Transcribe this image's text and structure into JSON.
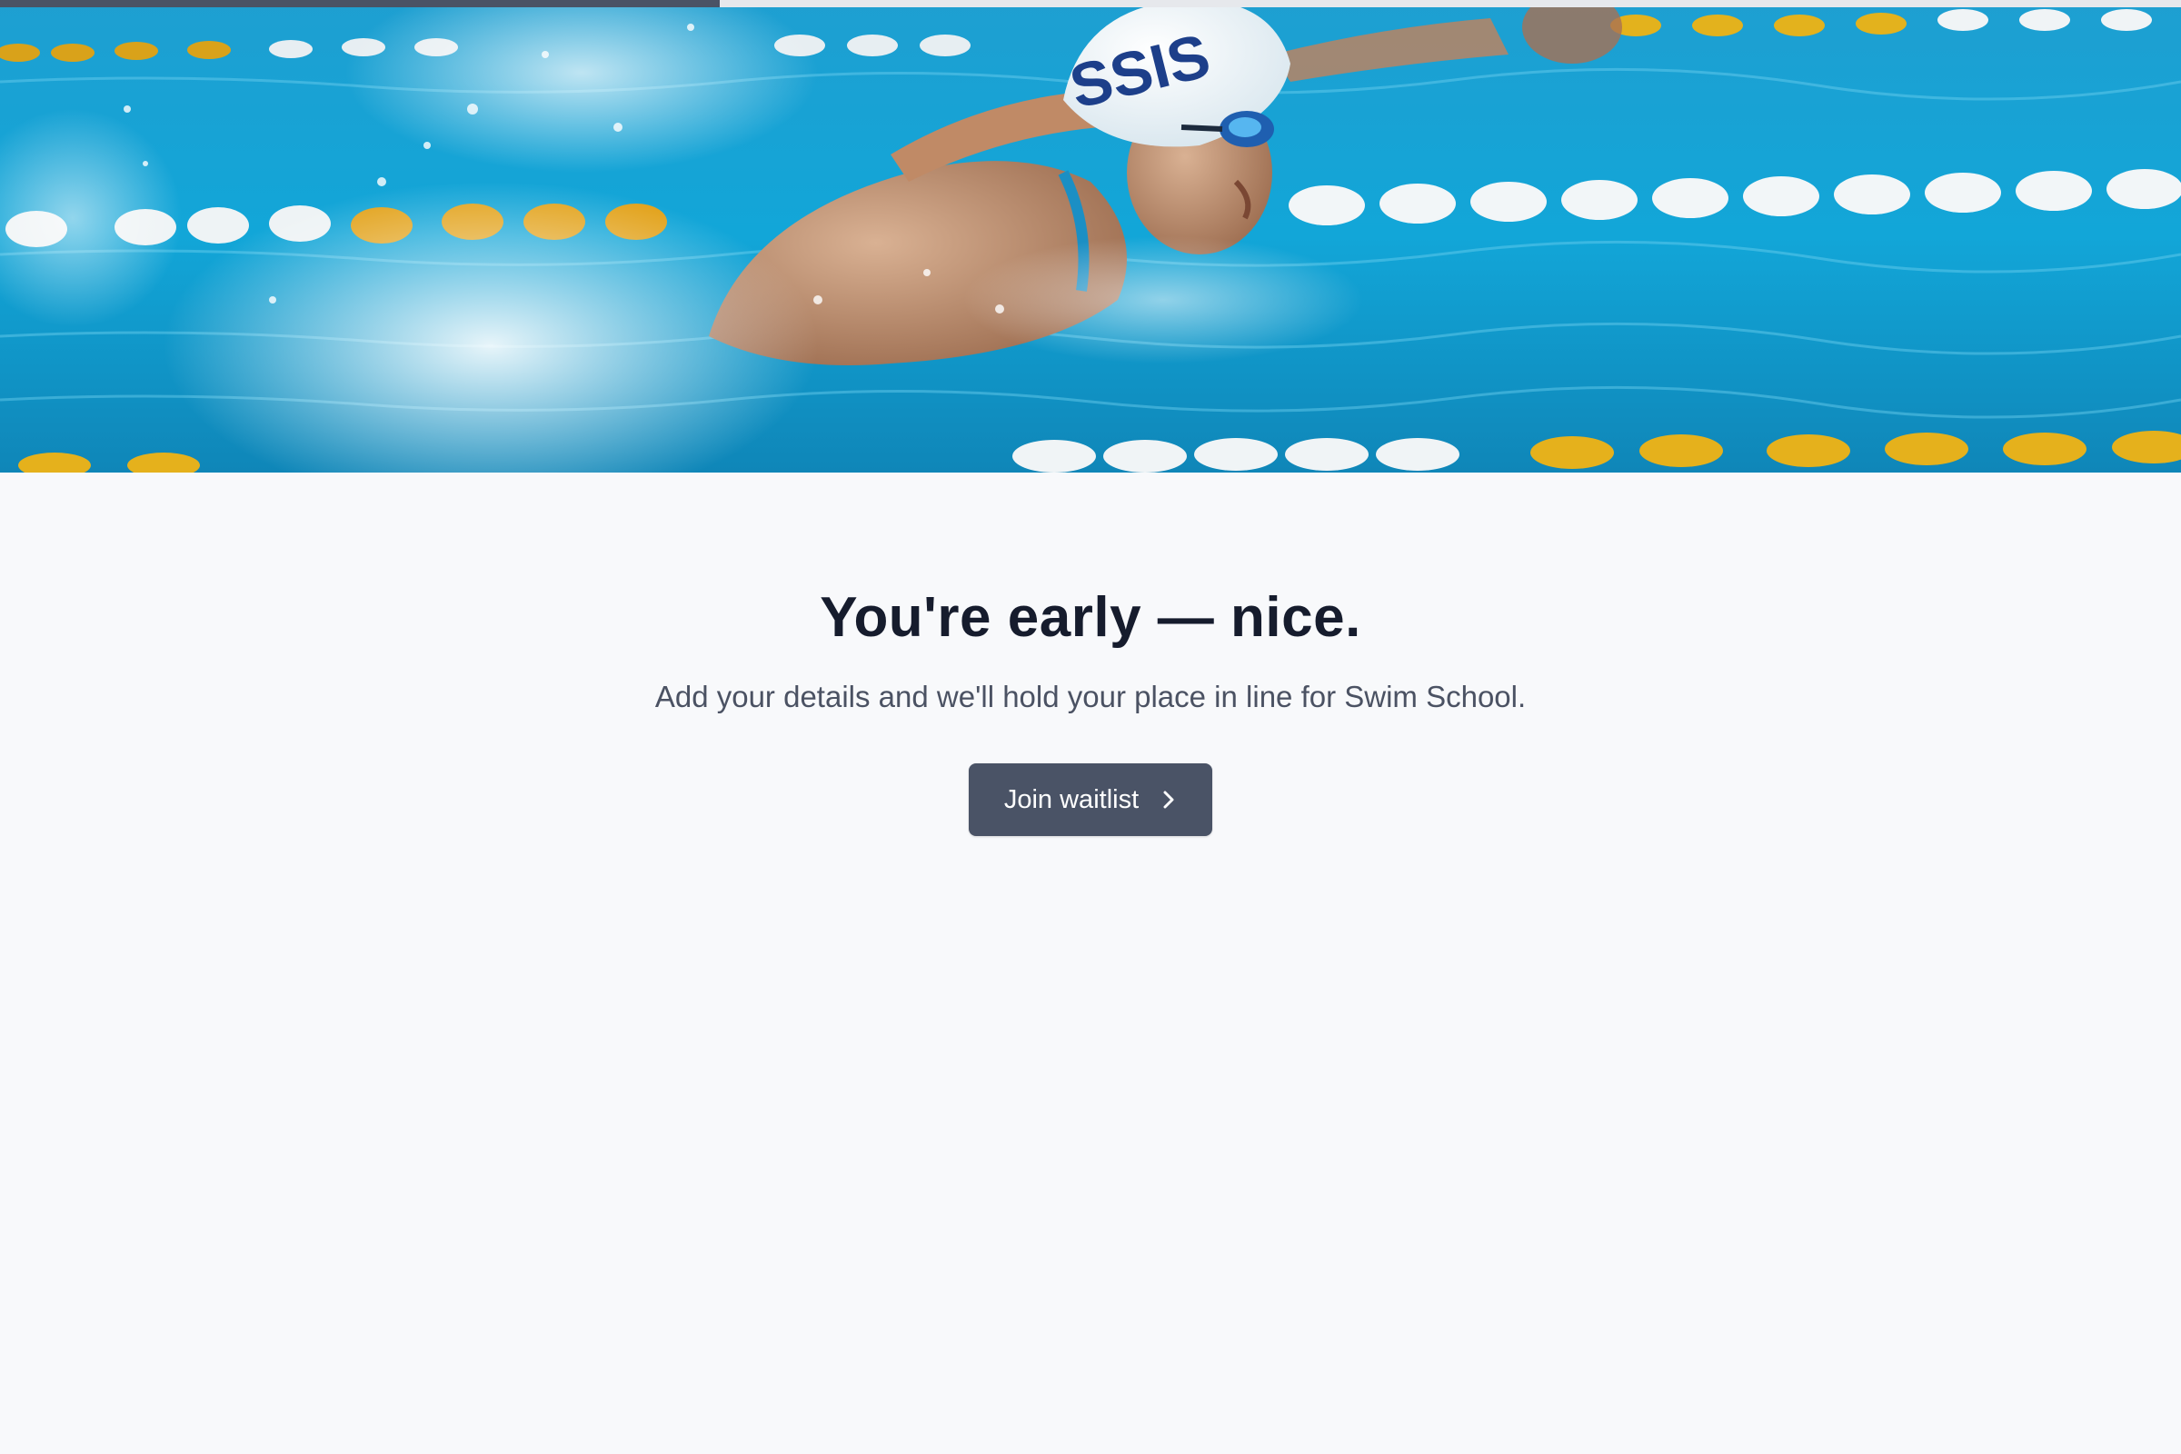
{
  "progress": {
    "value": 0.33,
    "fill_color": "#4a5365",
    "track_color": "#e6e8ec"
  },
  "hero": {
    "image": "swimmer-butterfly-pool-photo",
    "cap_text": "SSIS"
  },
  "main": {
    "headline": "You're early — nice.",
    "subtitle": "Add your details and we'll hold your place in line for Swim School.",
    "join_button": {
      "label": "Join waitlist",
      "icon": "chevron-right-icon",
      "color": "#4a5366"
    }
  },
  "colors": {
    "page_background": "#f8f9fb",
    "headline": "#161c2d",
    "subtitle": "#4b5263"
  }
}
